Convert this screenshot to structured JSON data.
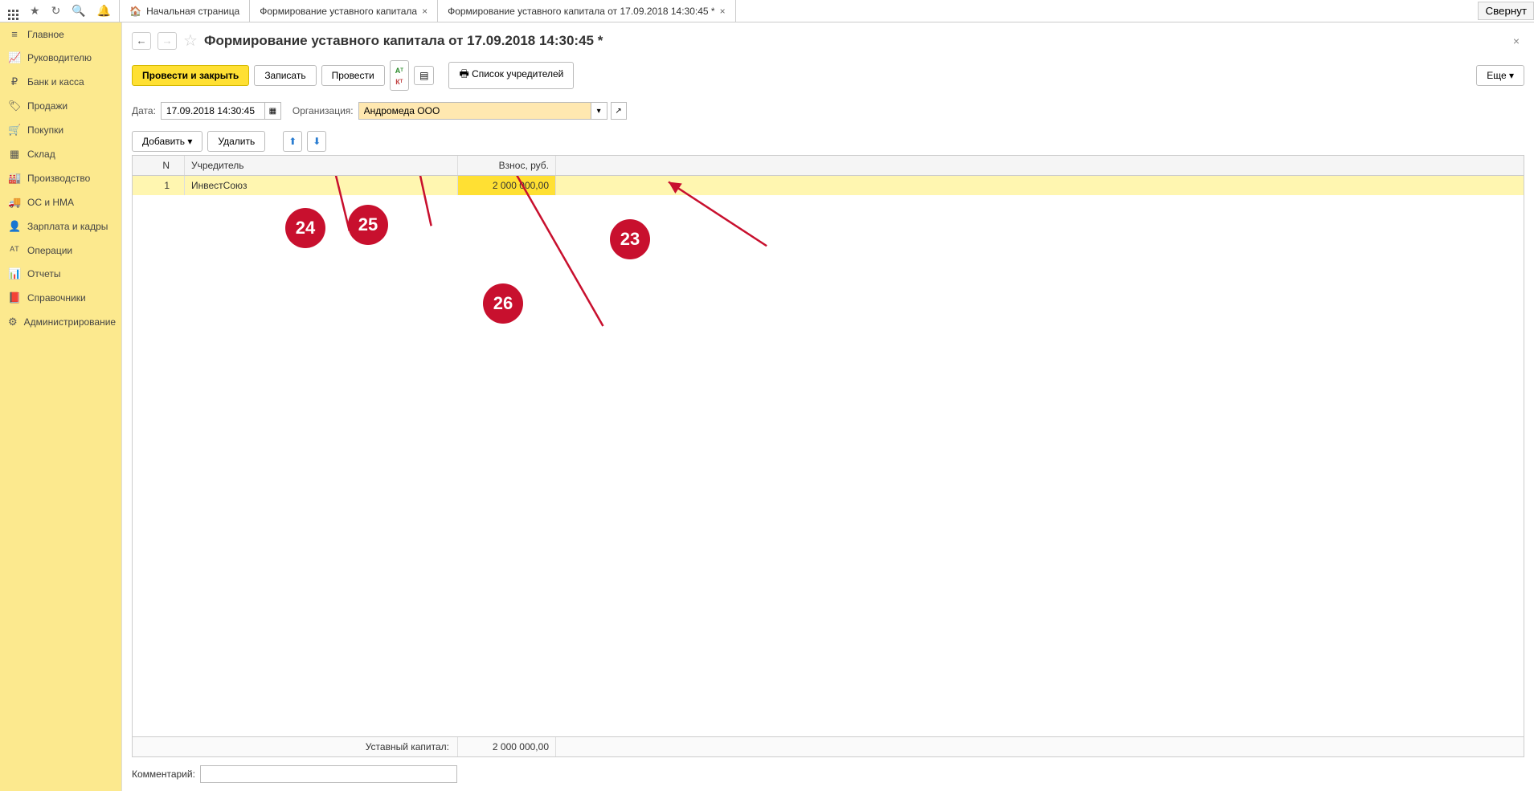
{
  "topbar": {
    "collapse": "Свернут",
    "tabs": [
      {
        "label": "Начальная страница",
        "closable": false,
        "icon": "home"
      },
      {
        "label": "Формирование уставного капитала",
        "closable": true
      },
      {
        "label": "Формирование уставного капитала от 17.09.2018 14:30:45 *",
        "closable": true
      }
    ]
  },
  "sidebar": {
    "items": [
      {
        "icon": "≡",
        "label": "Главное"
      },
      {
        "icon": "📈",
        "label": "Руководителю"
      },
      {
        "icon": "₽",
        "label": "Банк и касса"
      },
      {
        "icon": "🏷",
        "label": "Продажи"
      },
      {
        "icon": "🛒",
        "label": "Покупки"
      },
      {
        "icon": "▦",
        "label": "Склад"
      },
      {
        "icon": "🏭",
        "label": "Производство"
      },
      {
        "icon": "🚚",
        "label": "ОС и НМА"
      },
      {
        "icon": "👤",
        "label": "Зарплата и кадры"
      },
      {
        "icon": "ᴬᵀ",
        "label": "Операции"
      },
      {
        "icon": "📊",
        "label": "Отчеты"
      },
      {
        "icon": "📕",
        "label": "Справочники"
      },
      {
        "icon": "⚙",
        "label": "Администрирование"
      }
    ]
  },
  "doc": {
    "title": "Формирование уставного капитала от 17.09.2018 14:30:45 *",
    "toolbar": {
      "post_close": "Провести и закрыть",
      "save": "Записать",
      "post": "Провести",
      "founders_list": "Список учредителей",
      "more": "Еще"
    },
    "fields": {
      "date_label": "Дата:",
      "date_value": "17.09.2018 14:30:45",
      "org_label": "Организация:",
      "org_value": "Андромеда ООО"
    },
    "table_toolbar": {
      "add": "Добавить",
      "delete": "Удалить"
    },
    "table": {
      "headers": {
        "n": "N",
        "founder": "Учредитель",
        "amount": "Взнос, руб."
      },
      "rows": [
        {
          "n": "1",
          "founder": "ИнвестСоюз",
          "amount": "2 000 000,00"
        }
      ],
      "footer": {
        "label": "Уставный капитал:",
        "total": "2 000 000,00"
      }
    },
    "comment_label": "Комментарий:"
  },
  "annotations": {
    "a23": "23",
    "a24": "24",
    "a25": "25",
    "a26": "26"
  }
}
